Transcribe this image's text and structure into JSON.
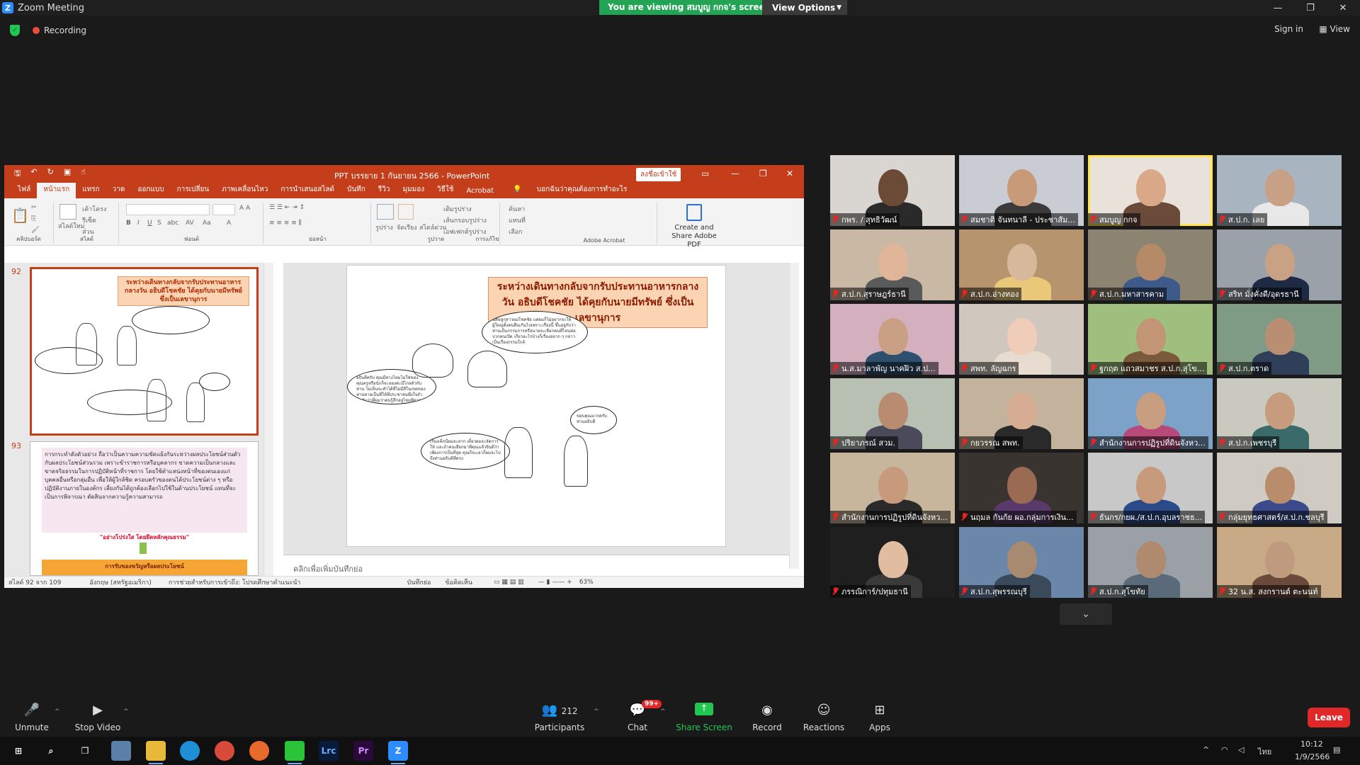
{
  "window": {
    "title": "Zoom Meeting"
  },
  "banner": {
    "viewing": "You are viewing สมบูญ กกจ's screen",
    "view_options": "View Options"
  },
  "status": {
    "recording": "Recording",
    "sign_in": "Sign in",
    "view": "View"
  },
  "powerpoint": {
    "doc_title": "PPT บรรยาย 1 กันยายน  2566  -  PowerPoint",
    "sign_in": "ลงชื่อเข้าใช้",
    "tabs": [
      "ไฟล์",
      "หน้าแรก",
      "แทรก",
      "วาด",
      "ออกแบบ",
      "การเปลี่ยน",
      "ภาพเคลื่อนไหว",
      "การนำเสนอสไลด์",
      "บันทึก",
      "รีวิว",
      "มุมมอง",
      "วิธีใช้",
      "Acrobat"
    ],
    "tell_me": "บอกฉันว่าคุณต้องการทำอะไร",
    "ribbon": {
      "new_slide": "สไลด์ใหม่",
      "layout": "เค้าโครง",
      "reset": "รีเซ็ต",
      "section": "ส่วน",
      "shapes": "รูปร่าง",
      "arrange": "จัดเรียง",
      "quick_styles": "สไตล์ด่วน",
      "shape_fill": "เติมรูปร่าง",
      "shape_outline": "เส้นกรอบรูปร่าง",
      "shape_effects": "เอฟเฟกต์รูปร่าง",
      "find": "ค้นหา",
      "replace": "แทนที่",
      "select": "เลือก",
      "create_pdf": "Create and Share Adobe PDF",
      "groups": [
        "คลิปบอร์ด",
        "สไลด์",
        "ฟอนต์",
        "ย่อหน้า",
        "รูปวาด",
        "การแก้ไข",
        "Adobe Acrobat"
      ]
    },
    "thumbnails": [
      {
        "num": "92",
        "caption": "ระหว่างเดินทางกลับจากรับประทานอาหารกลางวัน อธิบดีโชคชัย ได้คุยกับนายมีทรัพย์ ซึ่งเป็นเลขานุการ"
      },
      {
        "num": "93",
        "text": "การกระทำดังตัวอย่าง ถือว่าเป็นความความขัดแย้งกันระหว่างผลประโยชน์ส่วนตัวกับผลประโยชน์ส่วนรวม เพราะข้าราชการหรือบุคลากร ขาดความเป็นกลางและขาดจริยธรรมในการปฏิบัติหน้าที่ราชการ โดยใช้ตำแหน่งหน้าที่ของตนเองแก่บุคคลอื่นหรือกลุ่มอื่น เพื่อให้ผู้ใกล้ชิด ครอบครัวของตนได้ประโยชน์ต่าง ๆ หรือปฏิบัติงานภายในองค์กร เลี่ยงกันได้ถูกต้องเลือกไปใช้ในด้านประโยชน์ แทนที่จะเป็นการพิจารณา ตัดสินจากความรู้ความสามารถ",
        "highlight": "\"อย่างโปร่งใส โดยยึดหลักคุณธรรม\"",
        "footer": "การรับของขวัญหรือผลประโยชน์"
      }
    ],
    "slide": {
      "caption": "ระหว่างเดินทางกลับจากรับประทานอาหารกลางวัน อธิบดีโชคชัย ได้คุยกับนายมีทรัพย์ ซึ่งเป็นเลขานุการ",
      "bubble1": "นี่คือลูกสาวผมโชคชัย แต่ผมก็ไม่อยากจะให้ผู้ใหญ่ตั้งคนอื่นเกินไปเพราะเรื่องนี้ ขึ้นอยู่กับว่าท่านเป็นกรรมการหรือนายจะเลือกคนที่ไหนต่อบวกคนเปิด เกี่ยวอะไรบ้างก็เรื่องอยาก ๆ กล่าวเป็นเรื่องกรรมใกล้",
      "bubble2": "อธิบดีครับ คุณมีทางไหมไม่ใช่ของคุณครูหรือนักก็จะลองค่ะนี่ไกลตัวกับท่าน ไม่เห็นจะทำได้ที่ไม่มีสีในเขตของท่านหายเป็นที่ให้ที่ประชาชนพึงใจจำชื่อกันว่าที่ผมว่าคนรู้สึกอยู่ไหมพิจารณ์",
      "bubble3": "ขอบคุณมากครับ ท่านอธิบดี",
      "bubble4": "เรื่องเด็กนี่ผมจะยาก เดี๋ยวผมจะจัดการให้ และถ้าคนเลือกมาที่คุณแล้วยินดีว่าเพียงการเป็นที่สุด คุณก็จะเอาก็ผมจะไปถึงท่านอธิบดีที่ตรง"
    },
    "notes_placeholder": "คลิกเพื่อเพิ่มบันทึกย่อ",
    "status": {
      "slide_of": "สไลด์ 92 จาก 109",
      "language": "อังกฤษ (สหรัฐอเมริกา)",
      "accessibility": "การช่วยสำหรับการเข้าถึง: โปรดศึกษาคำแนะนำ",
      "notes": "บันทึกย่อ",
      "comments": "ข้อคิดเห็น",
      "zoom": "63%"
    }
  },
  "participants_grid": [
    {
      "name": "กพร. / สุทธิวัฒน์",
      "bg": "#d9d6d1",
      "skin": "#6b4a36",
      "shirt": "#2a2a2a"
    },
    {
      "name": "สมชาติ จันทนาลี - ประชาสัม...",
      "bg": "#c9cdd3",
      "skin": "#c99a78",
      "shirt": "#3b3b3b"
    },
    {
      "name": "สมบูญ กกจ",
      "bg": "#e8e2da",
      "skin": "#d8a888",
      "shirt": "#6b4a3a",
      "active": true
    },
    {
      "name": "ส.ป.ก. เลย",
      "bg": "#a8b4bf",
      "skin": "#c8a086",
      "shirt": "#e8e8e8"
    },
    {
      "name": "ส.ป.ก.สุราษฎร์ธานี",
      "bg": "#c9b9a4",
      "skin": "#e0b59a",
      "shirt": "#5a5a5a"
    },
    {
      "name": "ส.ป.ก.อ่างทอง",
      "bg": "#b5946e",
      "skin": "#d8b89a",
      "shirt": "#e9c87a"
    },
    {
      "name": "ส.ป.ก.มหาสารคาม",
      "bg": "#8c8470",
      "skin": "#b58a68",
      "shirt": "#3d5a8a"
    },
    {
      "name": "สริท มั่งคั่งดี/อุดรธานี",
      "bg": "#9aa1a8",
      "skin": "#c9a184",
      "shirt": "#1e2a44"
    },
    {
      "name": "น.ส.มาลาพัญ นาคฝิว ส.ป...",
      "bg": "#d4b0bf",
      "skin": "#caa084",
      "shirt": "#2f4f6f"
    },
    {
      "name": "สพท. ลัญฉกร",
      "bg": "#d0c8be",
      "skin": "#f0cdb8",
      "shirt": "#e8dcd0"
    },
    {
      "name": "ฐกฤต แถวสมาชร ส.ป.ก.สุโข...",
      "bg": "#9fbf7e",
      "skin": "#c29577",
      "shirt": "#7a5a3a"
    },
    {
      "name": "ส.ป.ก.ตราด",
      "bg": "#7f9b86",
      "skin": "#b98e72",
      "shirt": "#2f3f5a"
    },
    {
      "name": "ปริยาภรณ์ สวม.",
      "bg": "#b8c0b4",
      "skin": "#b98b70",
      "shirt": "#4a4a5a"
    },
    {
      "name": "กยวรรณ สพท.",
      "bg": "#c4b39c",
      "skin": "#d6ad92",
      "shirt": "#2a2a2a"
    },
    {
      "name": "สำนักงานการปฏิรูปที่ดินจังหว...",
      "bg": "#7ca2c8",
      "skin": "#c79e80",
      "shirt": "#b84a7a"
    },
    {
      "name": "ส.ป.ก.เพชรบุรี",
      "bg": "#c9c9c0",
      "skin": "#c79c7e",
      "shirt": "#3a6a6a"
    },
    {
      "name": "สำนักงานการปฏิรูปที่ดินจังหว...",
      "bg": "#c7b59c",
      "skin": "#c69a7a",
      "shirt": "#2a2a2a"
    },
    {
      "name": "นฤมล กันก้ย ผอ.กลุ่มการเงิน...",
      "bg": "#3a3430",
      "skin": "#9a6a52",
      "shirt": "#5a3a6a"
    },
    {
      "name": "ธันกร/กยผ./ส.ป.ก.อุบลราชธ...",
      "bg": "#c8c8c8",
      "skin": "#c89a7c",
      "shirt": "#2a4a8a"
    },
    {
      "name": "กลุ่มยุทธศาสตร์/ส.ป.ก.ชลบุรี",
      "bg": "#d0cbc2",
      "skin": "#b98c6c",
      "shirt": "#3a4a8a"
    },
    {
      "name": "ภรรณิการ์/ปทุมธานี",
      "bg": "#1f1f1f",
      "skin": "#e2bca0",
      "shirt": "#3a3a3a"
    },
    {
      "name": "ส.ป.ก.สุพรรณบุรี",
      "bg": "#6a86a8",
      "skin": "#a88a70",
      "shirt": "#3a4a5a"
    },
    {
      "name": "ส.ป.ก.สุโขทัย",
      "bg": "#9aa0a6",
      "skin": "#b08a6e",
      "shirt": "#5a6a7a"
    },
    {
      "name": "32 น.ส. สงกรานต์ ตะนนท์",
      "bg": "#c8ab86",
      "skin": "#bf9a7e",
      "shirt": "#6a4a3a"
    }
  ],
  "toolbar": {
    "unmute": "Unmute",
    "stop_video": "Stop Video",
    "participants": "Participants",
    "participants_count": "212",
    "chat": "Chat",
    "chat_badge": "99+",
    "share_screen": "Share Screen",
    "record": "Record",
    "reactions": "Reactions",
    "apps": "Apps",
    "leave": "Leave"
  },
  "taskbar": {
    "lang": "ไทย",
    "time": "10:12",
    "date": "1/9/2566"
  }
}
